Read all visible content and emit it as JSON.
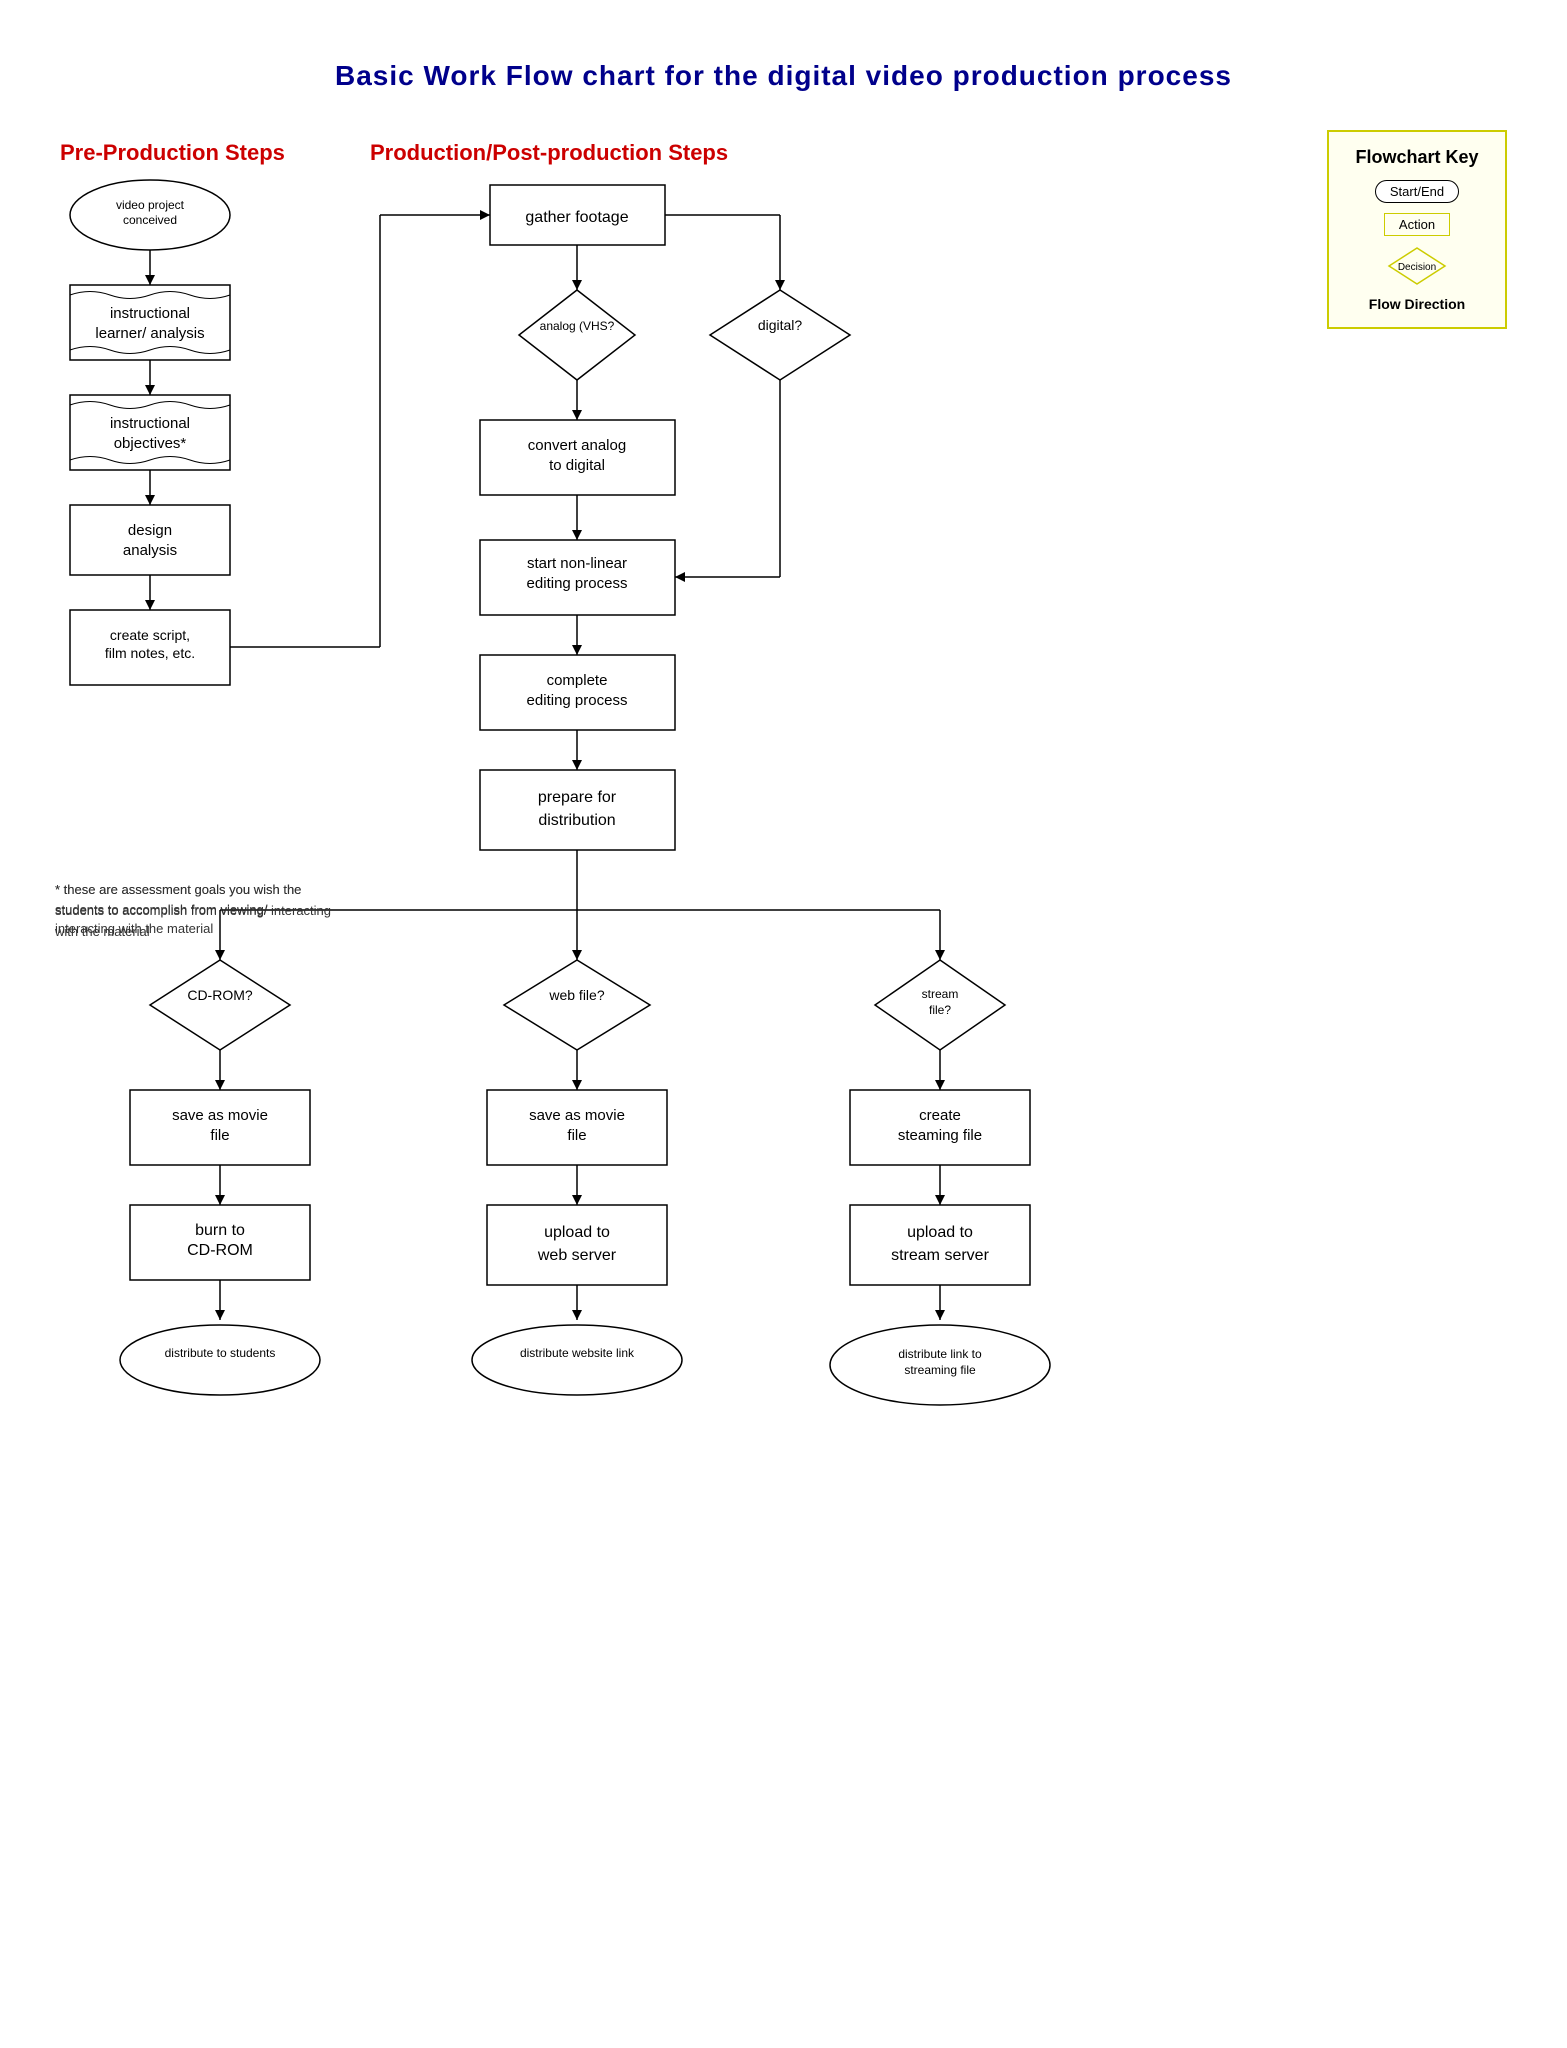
{
  "title": "Basic Work Flow chart for the digital video production process",
  "sections": {
    "pre_prod": "Pre-Production Steps",
    "prod": "Production/Post-production Steps"
  },
  "key": {
    "title": "Flowchart Key",
    "start_end": "Start/End",
    "action": "Action",
    "decision": "Decision",
    "flow": "Flow Direction"
  },
  "nodes": {
    "video_project": "video project\nconceived",
    "instructional_learner": "instructional\nlearner/ analysis",
    "instructional_objectives": "instructional\nobjectives*",
    "design_analysis": "design\nanalysis",
    "create_script": "create script,\nfilm notes, etc.",
    "gather_footage": "gather footage",
    "analog": "analog (VHS?",
    "digital": "digital?",
    "convert_analog": "convert analog\nto digital",
    "start_nonlinear": "start non-linear\nediting process",
    "complete_editing": "complete\nediting process",
    "prepare_distribution": "prepare for\ndistribution",
    "cdrom_q": "CD-ROM?",
    "web_q": "web file?",
    "stream_q": "stream\nfile?",
    "save_movie_cdrom": "save as movie\nfile",
    "save_movie_web": "save as movie\nfile",
    "create_streaming": "create\nsteaming file",
    "burn_cdrom": "burn to\nCD-ROM",
    "upload_web": "upload to\nweb server",
    "upload_stream": "upload to\nstream server",
    "distribute_students": "distribute to students",
    "distribute_website": "distribute website link",
    "distribute_streaming": "distribute link to\nstreaming file"
  },
  "footnote": "* these are assessment goals you wish the\nstudents to accomplish from viewing/ interacting\nwith the material"
}
